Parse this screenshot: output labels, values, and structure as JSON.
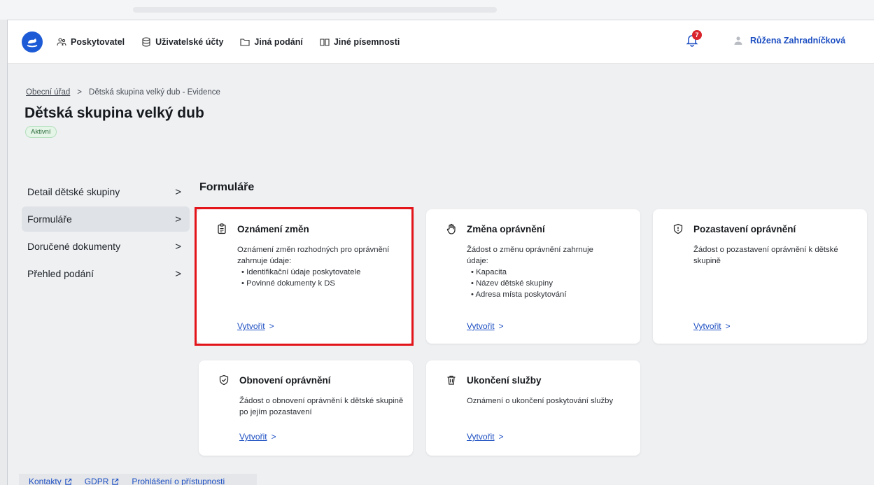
{
  "header": {
    "nav": [
      {
        "label": "Poskytovatel",
        "icon": "people-icon"
      },
      {
        "label": "Uživatelské účty",
        "icon": "database-icon"
      },
      {
        "label": "Jiná podání",
        "icon": "folder-icon"
      },
      {
        "label": "Jiné písemnosti",
        "icon": "book-icon"
      }
    ],
    "notifications_count": "7",
    "user_name": "Růžena Zahradníčková"
  },
  "breadcrumb": {
    "root": "Obecní úřad",
    "separator": ">",
    "current": "Dětská skupina velký dub - Evidence"
  },
  "page_title": "Dětská skupina velký dub",
  "status_badge": "Aktivní",
  "sidebar": {
    "items": [
      {
        "label": "Detail dětské skupiny",
        "active": false
      },
      {
        "label": "Formuláře",
        "active": true
      },
      {
        "label": "Doručené dokumenty",
        "active": false
      },
      {
        "label": "Přehled podání",
        "active": false
      }
    ],
    "chevron": ">"
  },
  "section_title": "Formuláře",
  "cards": [
    {
      "title": "Oznámení změn",
      "icon": "clipboard-icon",
      "intro": "Oznámení změn rozhodných pro oprávnění zahrnuje údaje:",
      "bullets": [
        "Identifikační údaje poskytovatele",
        "Povinné dokumenty k DS"
      ],
      "cta": "Vytvořit",
      "highlighted": true
    },
    {
      "title": "Změna oprávnění",
      "icon": "hand-icon",
      "intro": "Žádost o změnu oprávnění zahrnuje údaje:",
      "bullets": [
        "Kapacita",
        "Název dětské skupiny",
        "Adresa místa poskytování"
      ],
      "cta": "Vytvořit"
    },
    {
      "title": "Pozastavení oprávnění",
      "icon": "alert-shield-icon",
      "intro": "Žádost o pozastavení oprávnění k dětské skupině",
      "bullets": [],
      "cta": "Vytvořit"
    },
    {
      "title": "Obnovení oprávnění",
      "icon": "shield-check-icon",
      "intro": "Žádost o obnovení oprávnění k dětské skupině po jejím pozastavení",
      "bullets": [],
      "cta": "Vytvořit"
    },
    {
      "title": "Ukončení služby",
      "icon": "trash-icon",
      "intro": "Oznámení o ukončení poskytování služby",
      "bullets": [],
      "cta": "Vytvořit"
    }
  ],
  "cta_chevron": ">",
  "footer": {
    "links": [
      "Kontakty",
      "GDPR",
      "Prohlášení o přístupnosti"
    ]
  },
  "colors": {
    "accent": "#1d5bd6",
    "link": "#1d4fc2",
    "highlight": "#e3141a",
    "badge_bg": "#e5f5e8"
  }
}
